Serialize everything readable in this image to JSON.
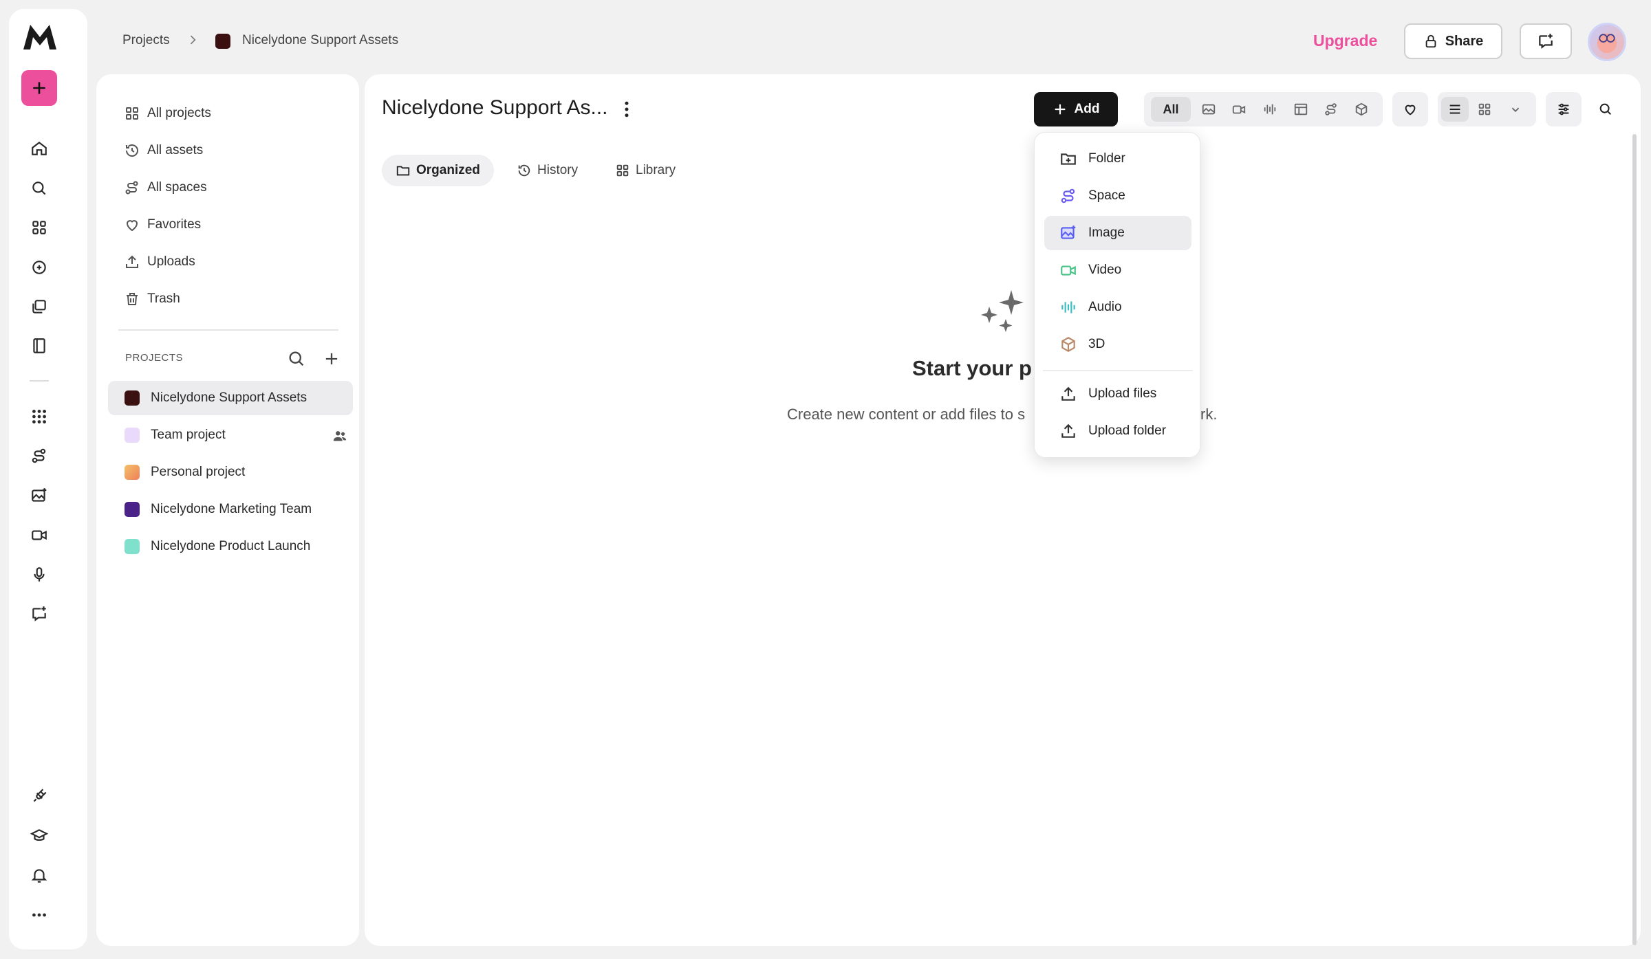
{
  "breadcrumb": {
    "root": "Projects",
    "current": "Nicelydone Support Assets",
    "current_color": "#3a1010"
  },
  "header": {
    "upgrade_label": "Upgrade",
    "share_label": "Share"
  },
  "sidebar": {
    "nav": [
      {
        "label": "All projects",
        "icon": "grid-icon"
      },
      {
        "label": "All assets",
        "icon": "history-icon"
      },
      {
        "label": "All spaces",
        "icon": "spaces-icon"
      },
      {
        "label": "Favorites",
        "icon": "heart-icon"
      },
      {
        "label": "Uploads",
        "icon": "upload-icon"
      },
      {
        "label": "Trash",
        "icon": "trash-icon"
      }
    ],
    "projects_label": "PROJECTS",
    "projects": [
      {
        "label": "Nicelydone Support Assets",
        "color": "#3a1010"
      },
      {
        "label": "Team project",
        "color": "#e9d9fb"
      },
      {
        "label": "Personal project",
        "color": "#f3a860"
      },
      {
        "label": "Nicelydone Marketing Team",
        "color": "#4b2287"
      },
      {
        "label": "Nicelydone Product Launch",
        "color": "#7fe0cc"
      }
    ]
  },
  "main": {
    "title": "Nicelydone Support As...",
    "tabs": [
      {
        "label": "Organized"
      },
      {
        "label": "History"
      },
      {
        "label": "Library"
      }
    ],
    "add_label": "Add",
    "filter_all": "All",
    "empty_title_visible": "Start your p",
    "empty_sub_left": "Create new content or add files to s",
    "empty_sub_right": "rk."
  },
  "add_menu": {
    "items": [
      {
        "label": "Folder",
        "icon": "folder-plus-icon"
      },
      {
        "label": "Space",
        "icon": "space-icon"
      },
      {
        "label": "Image",
        "icon": "image-icon"
      },
      {
        "label": "Video",
        "icon": "video-icon"
      },
      {
        "label": "Audio",
        "icon": "audio-icon"
      },
      {
        "label": "3D",
        "icon": "cube-icon"
      },
      {
        "label": "Upload files",
        "icon": "upload-icon"
      },
      {
        "label": "Upload folder",
        "icon": "upload-icon"
      }
    ]
  },
  "colors": {
    "accent": "#ec4f9b",
    "button_dark": "#161616"
  }
}
